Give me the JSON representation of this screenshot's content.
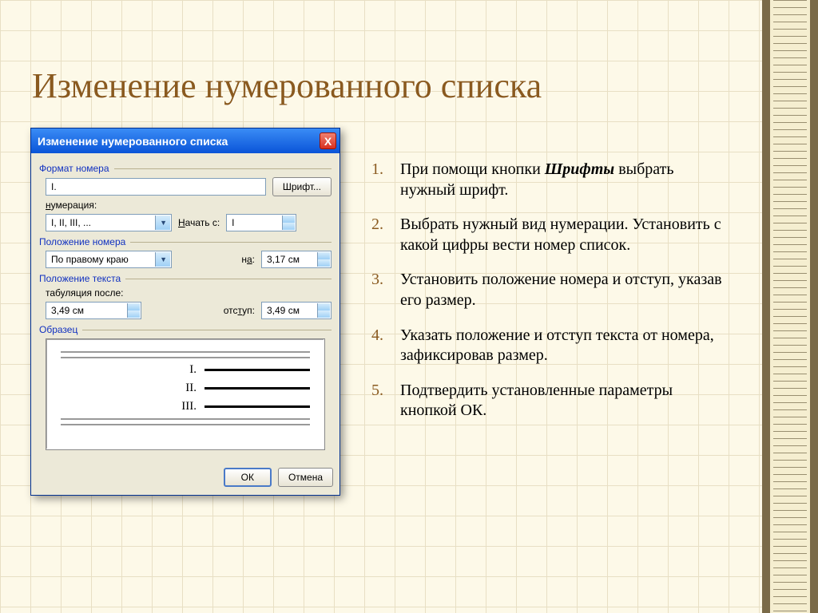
{
  "slide": {
    "title": "Изменение нумерованного списка"
  },
  "dialog": {
    "title": "Изменение нумерованного списка",
    "close": "X",
    "groups": {
      "number_format_label": "Формат номера",
      "number_format_value": "I.",
      "font_button": "Шрифт...",
      "numbering_label": "нумерация:",
      "numbering_value": "I, II, III, ...",
      "start_at_label": "начать с:",
      "start_at_value": "I",
      "number_position_label": "Положение номера",
      "alignment_value": "По правому краю",
      "at_label": "на:",
      "at_value": "3,17 см",
      "text_position_label": "Положение текста",
      "tab_after_label": "табуляция после:",
      "tab_after_value": "3,49 см",
      "indent_label": "отступ:",
      "indent_value": "3,49 см",
      "preview_label": "Образец",
      "preview_numerals": [
        "I.",
        "II.",
        "III."
      ]
    },
    "buttons": {
      "ok": "ОК",
      "cancel": "Отмена"
    }
  },
  "instructions": {
    "items": [
      {
        "n": "1.",
        "pre": "При помощи кнопки ",
        "bold": "Шрифты",
        "post": " выбрать нужный шрифт."
      },
      {
        "n": "2.",
        "pre": "Выбрать нужный вид нумерации. Установить с какой цифры вести номер список.",
        "bold": "",
        "post": ""
      },
      {
        "n": "3.",
        "pre": "Установить положение номера и отступ, указав его размер.",
        "bold": "",
        "post": ""
      },
      {
        "n": "4.",
        "pre": "Указать положение и отступ текста от номера, зафиксировав размер.",
        "bold": "",
        "post": ""
      },
      {
        "n": "5.",
        "pre": "Подтвердить установленные параметры кнопкой ОК.",
        "bold": "",
        "post": ""
      }
    ]
  }
}
